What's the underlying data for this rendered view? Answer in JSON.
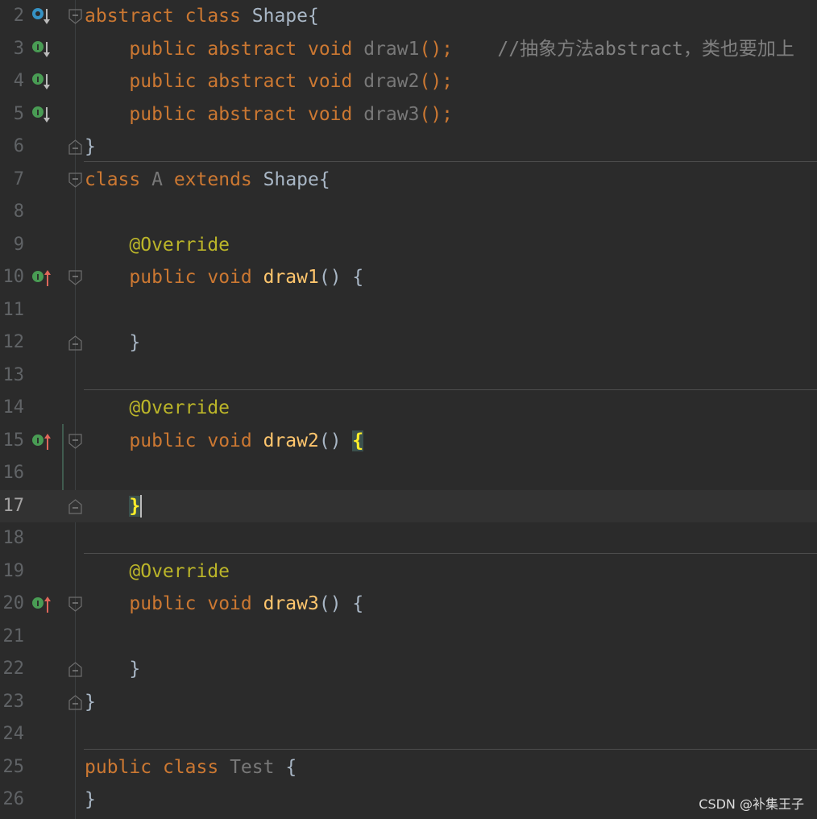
{
  "colors": {
    "background": "#2b2b2b",
    "keyword": "#cc7832",
    "function": "#ffc66d",
    "annotation": "#bbb529",
    "comment": "#808080",
    "text": "#a9b7c6"
  },
  "lines": [
    {
      "num": "2",
      "tokens": {
        "a": "abstract",
        "b": "class",
        "c": "Shape",
        "d": "{"
      }
    },
    {
      "num": "3",
      "tokens": {
        "a": "public",
        "b": "abstract",
        "c": "void",
        "d": "draw1",
        "e": "();",
        "f": "//抽象方法abstract，类也要加上"
      }
    },
    {
      "num": "4",
      "tokens": {
        "a": "public",
        "b": "abstract",
        "c": "void",
        "d": "draw2",
        "e": "();"
      }
    },
    {
      "num": "5",
      "tokens": {
        "a": "public",
        "b": "abstract",
        "c": "void",
        "d": "draw3",
        "e": "();"
      }
    },
    {
      "num": "6",
      "tokens": {
        "a": "}"
      }
    },
    {
      "num": "7",
      "tokens": {
        "a": "class",
        "b": "A",
        "c": "extends",
        "d": "Shape",
        "e": "{"
      }
    },
    {
      "num": "8",
      "tokens": {}
    },
    {
      "num": "9",
      "tokens": {
        "a": "@Override"
      }
    },
    {
      "num": "10",
      "tokens": {
        "a": "public",
        "b": "void",
        "c": "draw1",
        "d": "()",
        "e": "{"
      }
    },
    {
      "num": "11",
      "tokens": {}
    },
    {
      "num": "12",
      "tokens": {
        "a": "}"
      }
    },
    {
      "num": "13",
      "tokens": {}
    },
    {
      "num": "14",
      "tokens": {
        "a": "@Override"
      }
    },
    {
      "num": "15",
      "tokens": {
        "a": "public",
        "b": "void",
        "c": "draw2",
        "d": "()",
        "e": "{"
      }
    },
    {
      "num": "16",
      "tokens": {}
    },
    {
      "num": "17",
      "tokens": {
        "a": "}"
      }
    },
    {
      "num": "18",
      "tokens": {}
    },
    {
      "num": "19",
      "tokens": {
        "a": "@Override"
      }
    },
    {
      "num": "20",
      "tokens": {
        "a": "public",
        "b": "void",
        "c": "draw3",
        "d": "()",
        "e": "{"
      }
    },
    {
      "num": "21",
      "tokens": {}
    },
    {
      "num": "22",
      "tokens": {
        "a": "}"
      }
    },
    {
      "num": "23",
      "tokens": {
        "a": "}"
      }
    },
    {
      "num": "24",
      "tokens": {}
    },
    {
      "num": "25",
      "tokens": {
        "a": "public",
        "b": "class",
        "c": "Test",
        "d": "{"
      }
    },
    {
      "num": "26",
      "tokens": {
        "a": "}"
      }
    }
  ],
  "gutter_icons": {
    "line2": "class-implemented-icon",
    "line3": "abstract-method-implemented-icon",
    "line10": "implements-method-icon"
  },
  "watermark": "CSDN @补集王子"
}
